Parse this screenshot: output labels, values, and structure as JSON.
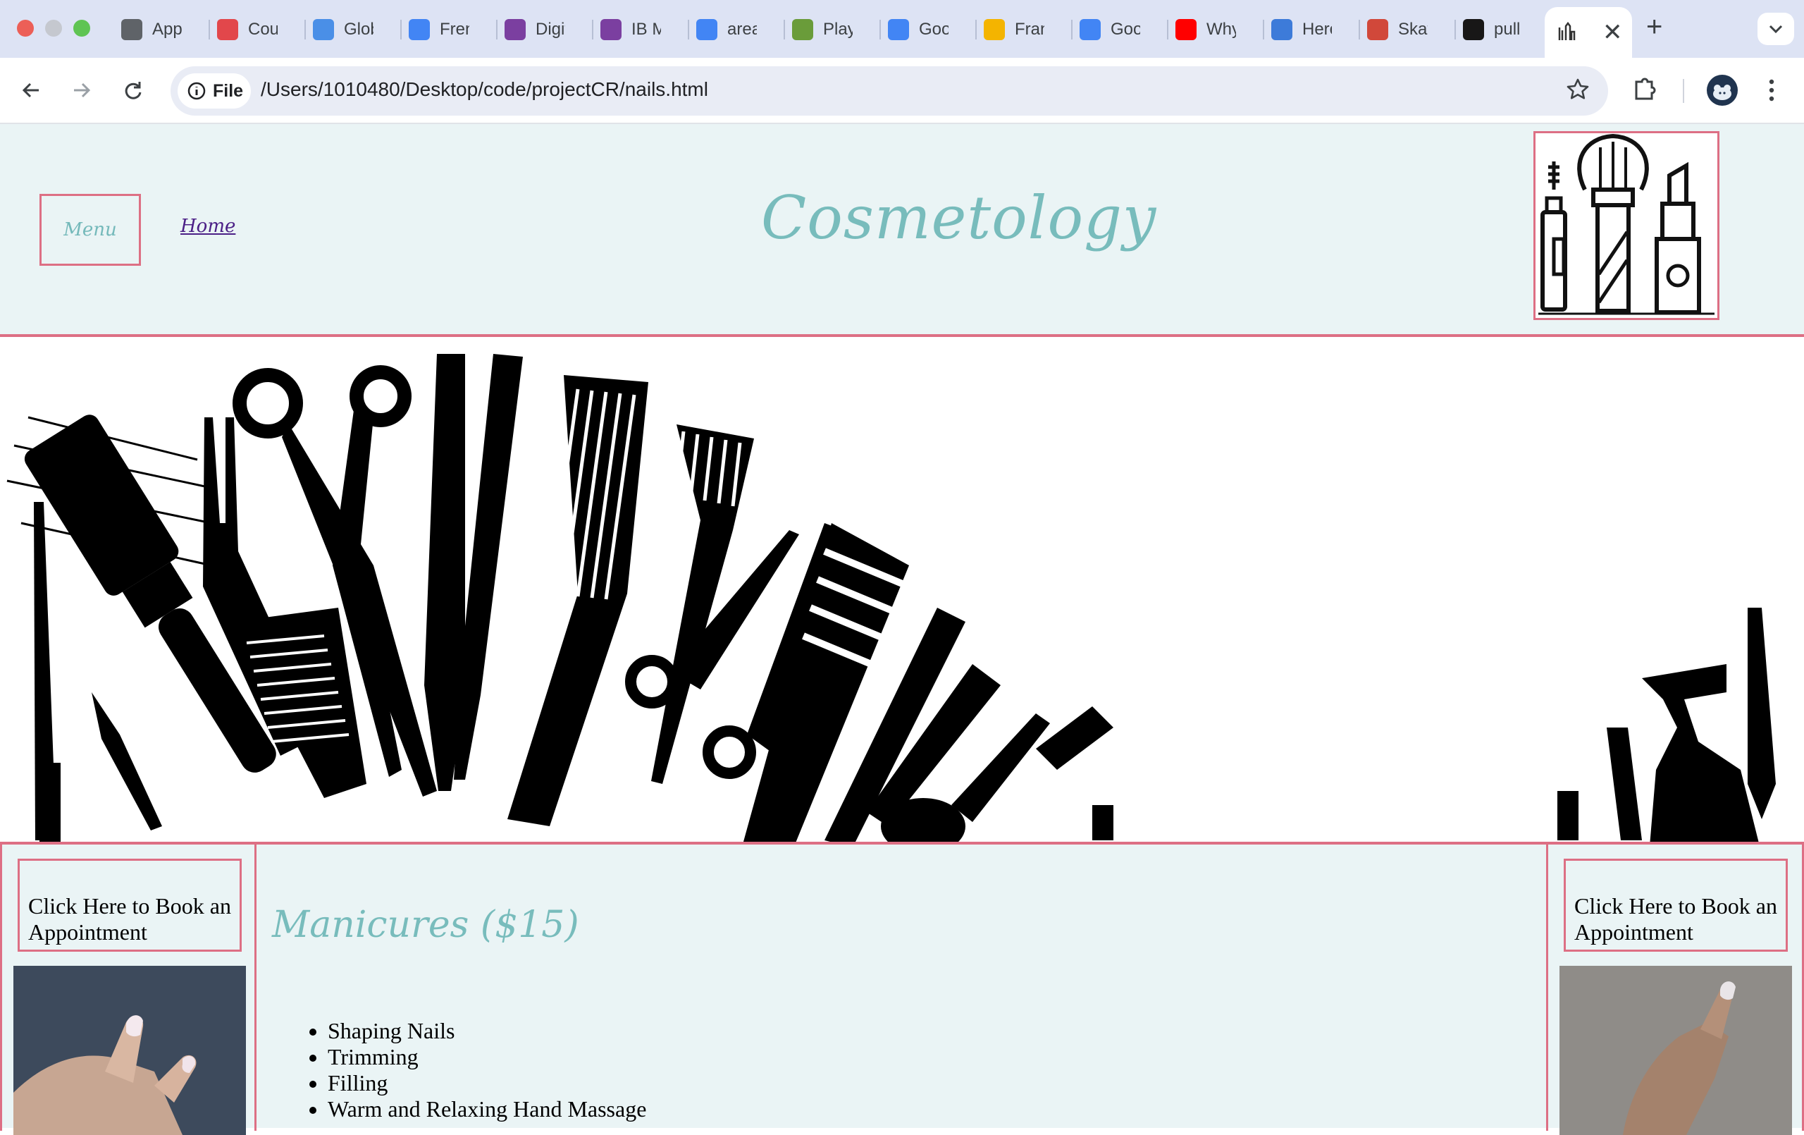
{
  "browser": {
    "tabs": [
      {
        "label": "Apps",
        "icon": "globe-icon",
        "color": "#5f6368"
      },
      {
        "label": "Course",
        "icon": "canvas-icon",
        "color": "#e2474b"
      },
      {
        "label": "Global",
        "icon": "cloud-icon",
        "color": "#4a8fe7"
      },
      {
        "label": "French",
        "icon": "docs-icon",
        "color": "#4285f4"
      },
      {
        "label": "Digital",
        "icon": "edge-icon",
        "color": "#7b3fa0"
      },
      {
        "label": "IB Math",
        "icon": "edge-icon",
        "color": "#7b3fa0"
      },
      {
        "label": "area",
        "icon": "google-icon",
        "color": "#4285f4"
      },
      {
        "label": "Play",
        "icon": "chess-icon",
        "color": "#6a9c3a"
      },
      {
        "label": "Google",
        "icon": "google-icon",
        "color": "#4285f4"
      },
      {
        "label": "France",
        "icon": "slides-icon",
        "color": "#f4b400"
      },
      {
        "label": "Google",
        "icon": "translate-icon",
        "color": "#4285f4"
      },
      {
        "label": "Why",
        "icon": "youtube-icon",
        "color": "#ff0000"
      },
      {
        "label": "Here",
        "icon": "css-icon",
        "color": "#3d7bd9"
      },
      {
        "label": "Skate",
        "icon": "sb-icon",
        "color": "#d1483a"
      },
      {
        "label": "pull",
        "icon": "github-icon",
        "color": "#181717"
      }
    ],
    "active_tab": {
      "icon": "cosmetics-icon",
      "close": "✕"
    },
    "new_tab": "+",
    "address": {
      "chip_label": "File",
      "url": "/Users/1010480/Desktop/code/projectCR/nails.html"
    }
  },
  "site": {
    "menu_label": "Menu",
    "home_label": "Home",
    "title": "Cosmetology",
    "book_left": "Click Here to Book an Appointment",
    "book_right": "Click Here to Book an Appointment",
    "section_title": "Manicures ($15)",
    "services": [
      "Shaping Nails",
      "Trimming",
      "Filling",
      "Warm and Relaxing Hand Massage"
    ]
  },
  "colors": {
    "accent_border": "#dd6f84",
    "title_teal": "#78bcbc",
    "header_bg": "#eaf4f5",
    "link_purple": "#4b1f86"
  }
}
